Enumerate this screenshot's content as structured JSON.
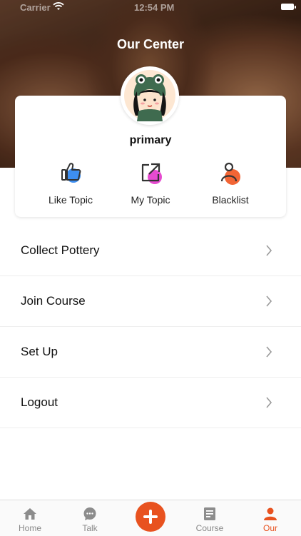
{
  "status_bar": {
    "carrier": "Carrier",
    "time": "12:54 PM"
  },
  "header": {
    "title": "Our Center"
  },
  "profile": {
    "username": "primary",
    "avatar_icon": "frog-hat-girl-avatar"
  },
  "actions": [
    {
      "label": "Like Topic",
      "icon": "thumbs-up-icon",
      "accent": "#3d8ef0"
    },
    {
      "label": "My Topic",
      "icon": "share-external-icon",
      "accent": "#e64bd0"
    },
    {
      "label": "Blacklist",
      "icon": "user-block-icon",
      "accent": "#f26535"
    }
  ],
  "menu": {
    "items": [
      {
        "label": "Collect Pottery"
      },
      {
        "label": "Join Course"
      },
      {
        "label": "Set Up"
      },
      {
        "label": "Logout"
      }
    ]
  },
  "tabbar": {
    "tabs": [
      {
        "label": "Home",
        "icon": "home-icon",
        "active": false
      },
      {
        "label": "Talk",
        "icon": "chat-icon",
        "active": false
      },
      {
        "label": "",
        "icon": "add-icon",
        "active": false
      },
      {
        "label": "Course",
        "icon": "document-icon",
        "active": false
      },
      {
        "label": "Our",
        "icon": "person-icon",
        "active": true
      }
    ],
    "accent": "#e8521f",
    "inactive_color": "#888888"
  }
}
